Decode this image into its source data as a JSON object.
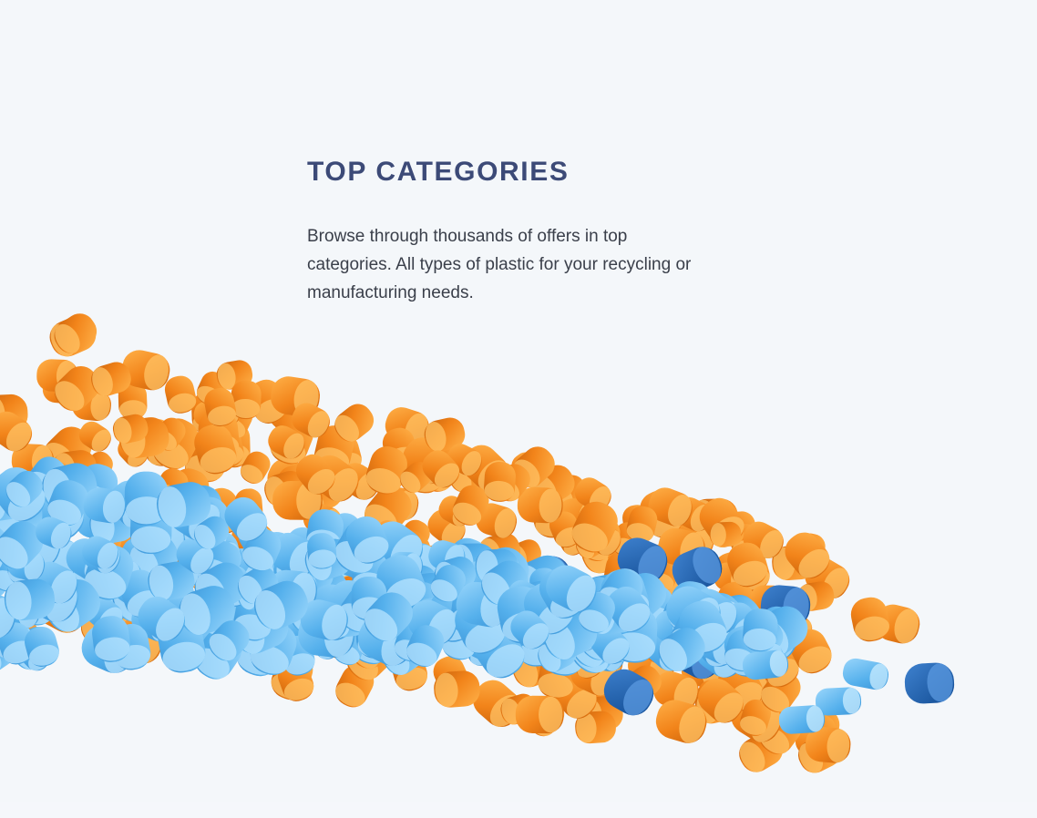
{
  "section": {
    "title": "TOP CATEGORIES",
    "description": "Browse through thousands of offers in top categories. All types of plastic for your recycling or manufacturing needs."
  },
  "colors": {
    "background": "#f4f7fa",
    "title": "#3c4a77",
    "text": "#3a3f4a",
    "orange": "#f08a1c",
    "light_blue": "#5fb6ec",
    "dark_blue": "#1f64b3"
  },
  "image": {
    "subject": "plastic-pellets-illustration"
  }
}
